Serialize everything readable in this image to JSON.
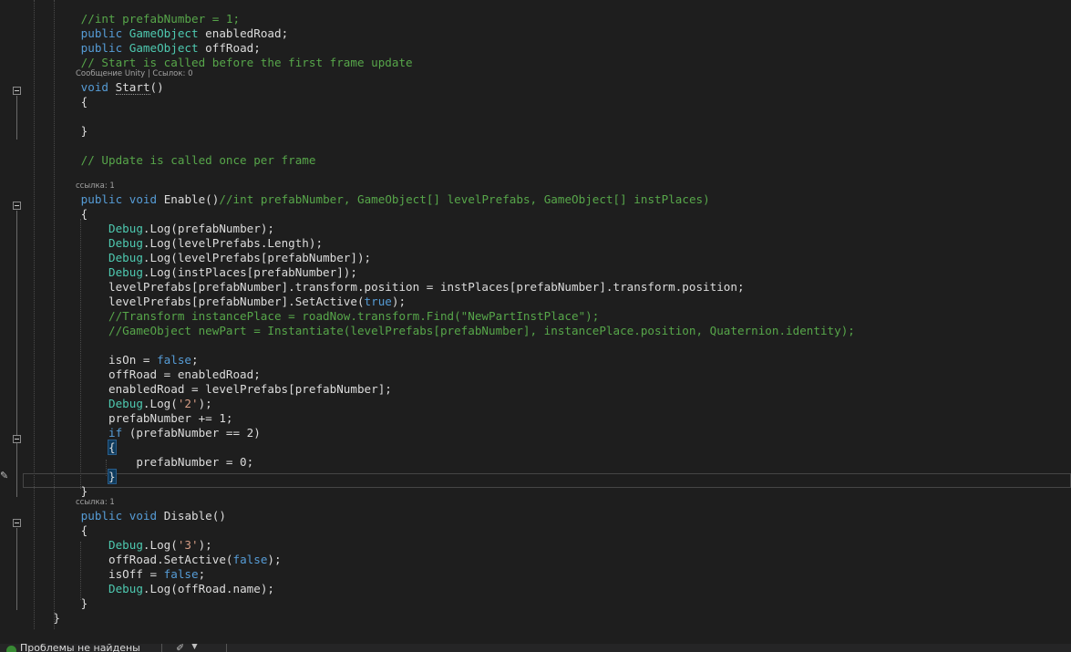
{
  "editor": {
    "lines": [
      {
        "indent": "        ",
        "tokens": [
          {
            "c": "cm",
            "t": "//int prefabNumber = 1;"
          }
        ]
      },
      {
        "indent": "        ",
        "tokens": [
          {
            "c": "kw",
            "t": "public"
          },
          {
            "c": "tx",
            "t": " "
          },
          {
            "c": "ty",
            "t": "GameObject"
          },
          {
            "c": "tx",
            "t": " enabledRoad;"
          }
        ]
      },
      {
        "indent": "        ",
        "tokens": [
          {
            "c": "kw",
            "t": "public"
          },
          {
            "c": "tx",
            "t": " "
          },
          {
            "c": "ty",
            "t": "GameObject"
          },
          {
            "c": "tx",
            "t": " offRoad;"
          }
        ]
      },
      {
        "indent": "        ",
        "tokens": [
          {
            "c": "cm",
            "t": "// Start is called before the first frame update"
          }
        ]
      },
      {
        "indent": "        ",
        "tokens": [
          {
            "c": "kw",
            "t": "void"
          },
          {
            "c": "tx",
            "t": " "
          },
          {
            "c": "tx",
            "t": "Start",
            "u": true
          },
          {
            "c": "tx",
            "t": "()"
          }
        ]
      },
      {
        "indent": "        ",
        "tokens": [
          {
            "c": "tx",
            "t": "{"
          }
        ]
      },
      {
        "indent": "",
        "tokens": []
      },
      {
        "indent": "        ",
        "tokens": [
          {
            "c": "tx",
            "t": "}"
          }
        ]
      },
      {
        "indent": "",
        "tokens": []
      },
      {
        "indent": "        ",
        "tokens": [
          {
            "c": "cm",
            "t": "// Update is called once per frame"
          }
        ]
      },
      {
        "indent": "",
        "tokens": []
      },
      {
        "indent": "        ",
        "tokens": [
          {
            "c": "kw",
            "t": "public"
          },
          {
            "c": "tx",
            "t": " "
          },
          {
            "c": "kw",
            "t": "void"
          },
          {
            "c": "tx",
            "t": " Enable()"
          },
          {
            "c": "cm",
            "t": "//int prefabNumber, GameObject[] levelPrefabs, GameObject[] instPlaces)"
          }
        ]
      },
      {
        "indent": "        ",
        "tokens": [
          {
            "c": "tx",
            "t": "{"
          }
        ]
      },
      {
        "indent": "            ",
        "tokens": [
          {
            "c": "ty",
            "t": "Debug"
          },
          {
            "c": "tx",
            "t": ".Log(prefabNumber);"
          }
        ]
      },
      {
        "indent": "            ",
        "tokens": [
          {
            "c": "ty",
            "t": "Debug"
          },
          {
            "c": "tx",
            "t": ".Log(levelPrefabs.Length);"
          }
        ]
      },
      {
        "indent": "            ",
        "tokens": [
          {
            "c": "ty",
            "t": "Debug"
          },
          {
            "c": "tx",
            "t": ".Log(levelPrefabs[prefabNumber]);"
          }
        ]
      },
      {
        "indent": "            ",
        "tokens": [
          {
            "c": "ty",
            "t": "Debug"
          },
          {
            "c": "tx",
            "t": ".Log(instPlaces[prefabNumber]);"
          }
        ]
      },
      {
        "indent": "            ",
        "tokens": [
          {
            "c": "tx",
            "t": "levelPrefabs[prefabNumber].transform.position = instPlaces[prefabNumber].transform.position;"
          }
        ]
      },
      {
        "indent": "            ",
        "tokens": [
          {
            "c": "tx",
            "t": "levelPrefabs[prefabNumber].SetActive("
          },
          {
            "c": "kw",
            "t": "true"
          },
          {
            "c": "tx",
            "t": ");"
          }
        ]
      },
      {
        "indent": "            ",
        "tokens": [
          {
            "c": "cm",
            "t": "//Transform instancePlace = roadNow.transform.Find(\"NewPartInstPlace\");"
          }
        ]
      },
      {
        "indent": "            ",
        "tokens": [
          {
            "c": "cm",
            "t": "//GameObject newPart = Instantiate(levelPrefabs[prefabNumber], instancePlace.position, Quaternion.identity);"
          }
        ]
      },
      {
        "indent": "",
        "tokens": []
      },
      {
        "indent": "            ",
        "tokens": [
          {
            "c": "tx",
            "t": "isOn = "
          },
          {
            "c": "kw",
            "t": "false"
          },
          {
            "c": "tx",
            "t": ";"
          }
        ]
      },
      {
        "indent": "            ",
        "tokens": [
          {
            "c": "tx",
            "t": "offRoad = enabledRoad;"
          }
        ]
      },
      {
        "indent": "            ",
        "tokens": [
          {
            "c": "tx",
            "t": "enabledRoad = levelPrefabs[prefabNumber];"
          }
        ]
      },
      {
        "indent": "            ",
        "tokens": [
          {
            "c": "ty",
            "t": "Debug"
          },
          {
            "c": "tx",
            "t": ".Log("
          },
          {
            "c": "st",
            "t": "'2'"
          },
          {
            "c": "tx",
            "t": ");"
          }
        ]
      },
      {
        "indent": "            ",
        "tokens": [
          {
            "c": "tx",
            "t": "prefabNumber += 1;"
          }
        ]
      },
      {
        "indent": "            ",
        "tokens": [
          {
            "c": "kw",
            "t": "if"
          },
          {
            "c": "tx",
            "t": " (prefabNumber == 2)"
          }
        ]
      },
      {
        "indent": "            ",
        "tokens": [
          {
            "c": "tx",
            "t": "{",
            "b": true
          }
        ]
      },
      {
        "indent": "                ",
        "tokens": [
          {
            "c": "tx",
            "t": "prefabNumber = 0;"
          }
        ]
      },
      {
        "indent": "            ",
        "tokens": [
          {
            "c": "tx",
            "t": "}",
            "b": true
          }
        ]
      },
      {
        "indent": "        ",
        "tokens": [
          {
            "c": "tx",
            "t": "}"
          }
        ]
      },
      {
        "indent": "        ",
        "tokens": [
          {
            "c": "kw",
            "t": "public"
          },
          {
            "c": "tx",
            "t": " "
          },
          {
            "c": "kw",
            "t": "void"
          },
          {
            "c": "tx",
            "t": " Disable()"
          }
        ]
      },
      {
        "indent": "        ",
        "tokens": [
          {
            "c": "tx",
            "t": "{"
          }
        ]
      },
      {
        "indent": "            ",
        "tokens": [
          {
            "c": "ty",
            "t": "Debug"
          },
          {
            "c": "tx",
            "t": ".Log("
          },
          {
            "c": "st",
            "t": "'3'"
          },
          {
            "c": "tx",
            "t": ");"
          }
        ]
      },
      {
        "indent": "            ",
        "tokens": [
          {
            "c": "tx",
            "t": "offRoad.SetActive("
          },
          {
            "c": "kw",
            "t": "false"
          },
          {
            "c": "tx",
            "t": ");"
          }
        ]
      },
      {
        "indent": "            ",
        "tokens": [
          {
            "c": "tx",
            "t": "isOff = "
          },
          {
            "c": "kw",
            "t": "false"
          },
          {
            "c": "tx",
            "t": ";"
          }
        ]
      },
      {
        "indent": "            ",
        "tokens": [
          {
            "c": "ty",
            "t": "Debug"
          },
          {
            "c": "tx",
            "t": ".Log(offRoad.name);"
          }
        ]
      },
      {
        "indent": "        ",
        "tokens": [
          {
            "c": "tx",
            "t": "}"
          }
        ]
      },
      {
        "indent": "    ",
        "tokens": [
          {
            "c": "tx",
            "t": "}"
          }
        ]
      }
    ],
    "codelens": [
      {
        "after_line": 3,
        "text": "Сообщение Unity | Ссылок: 0"
      },
      {
        "after_line": 10,
        "text": "ссылка: 1"
      },
      {
        "after_line": 31,
        "text": "ссылка: 1"
      }
    ],
    "colors": {
      "background": "#1e1e1e",
      "keyword": "#569cd6",
      "type": "#4ec9b0",
      "comment": "#57a64a",
      "string": "#d69d85",
      "text": "#dcdcdc"
    }
  },
  "statusbar": {
    "problems_label": "Проблемы не найдены",
    "ok_icon": "check-circle-icon",
    "tool_icon": "brush-icon",
    "dropdown_icon": "chevron-down-icon"
  }
}
